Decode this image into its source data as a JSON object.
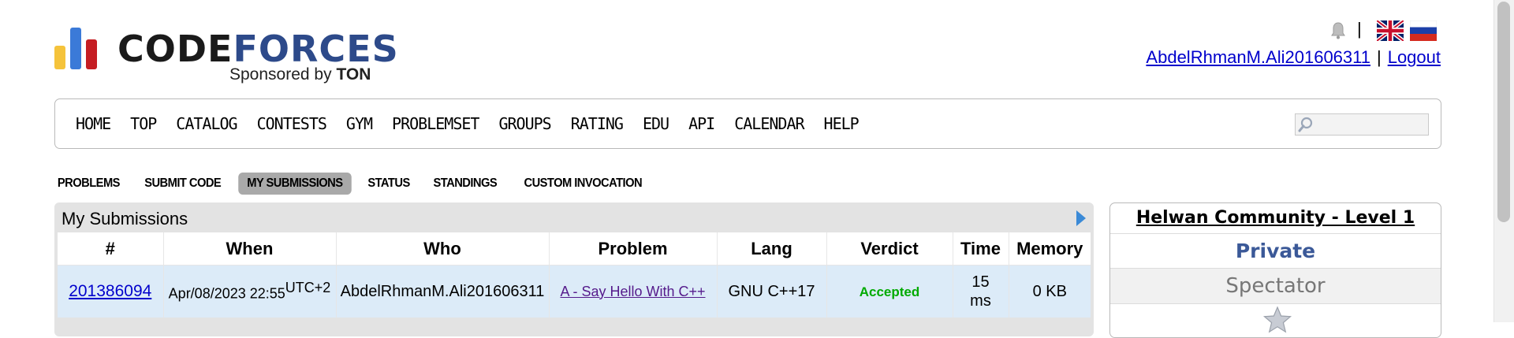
{
  "logo": {
    "word_part1": "CODE",
    "word_part2": "FORCES",
    "sponsor_prefix": "Sponsored by ",
    "sponsor_name": "TON",
    "bar_colors": [
      "#f5c33b",
      "#3b7ad8",
      "#c51d23"
    ]
  },
  "header": {
    "lang_separator": "|",
    "username": "AbdelRhmanM.Ali201606311",
    "separator": "|",
    "logout": "Logout",
    "icons": [
      "bell-icon",
      "uk-flag-icon",
      "russia-flag-icon"
    ]
  },
  "menu": {
    "items": [
      "HOME",
      "TOP",
      "CATALOG",
      "CONTESTS",
      "GYM",
      "PROBLEMSET",
      "GROUPS",
      "RATING",
      "EDU",
      "API",
      "CALENDAR",
      "HELP"
    ],
    "search_placeholder": ""
  },
  "submenu": {
    "items": [
      "PROBLEMS",
      "SUBMIT CODE",
      "MY SUBMISSIONS",
      "STATUS",
      "STANDINGS",
      "CUSTOM INVOCATION"
    ],
    "active": "MY SUBMISSIONS"
  },
  "submissions": {
    "title": "My Submissions",
    "columns": [
      "#",
      "When",
      "Who",
      "Problem",
      "Lang",
      "Verdict",
      "Time",
      "Memory"
    ],
    "rows": [
      {
        "id": "201386094",
        "when": "Apr/08/2023 22:55",
        "when_tz": "UTC+2",
        "who": "AbdelRhmanM.Ali201606311",
        "problem": "A - Say Hello With C++",
        "lang": "GNU C++17",
        "verdict": "Accepted",
        "time_value": "15",
        "time_unit": "ms",
        "memory": "0 KB"
      }
    ]
  },
  "sidebar": {
    "title": "Helwan Community - Level 1",
    "privacy": "Private",
    "role": "Spectator"
  },
  "colors": {
    "accent_blue": "#3b5998",
    "link": "#0000cc",
    "accepted": "#00aa00",
    "row_highlight": "#dcebf8"
  }
}
